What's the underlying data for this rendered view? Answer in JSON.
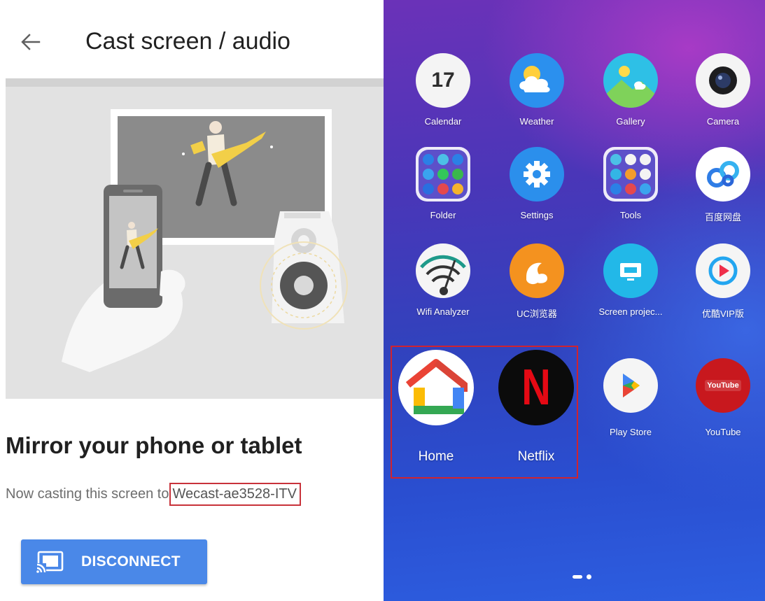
{
  "cast_screen": {
    "title": "Cast screen / audio",
    "heading": "Mirror your phone or tablet",
    "casting_prefix": "Now casting this screen to",
    "device_name": "Wecast-ae3528-ITV",
    "disconnect_label": "DISCONNECT",
    "colors": {
      "button": "#4a88e8",
      "highlight": "#c8323a"
    }
  },
  "home_screen": {
    "apps": [
      {
        "label": "Calendar",
        "icon": "calendar-icon",
        "text": "17"
      },
      {
        "label": "Weather",
        "icon": "weather-icon"
      },
      {
        "label": "Gallery",
        "icon": "gallery-icon"
      },
      {
        "label": "Camera",
        "icon": "camera-icon"
      },
      {
        "label": "Folder",
        "icon": "folder-icon"
      },
      {
        "label": "Settings",
        "icon": "settings-icon"
      },
      {
        "label": "Tools",
        "icon": "tools-icon"
      },
      {
        "label": "百度网盘",
        "icon": "baidu-netdisk-icon"
      },
      {
        "label": "Wifi Analyzer",
        "icon": "wifi-analyzer-icon"
      },
      {
        "label": "UC浏览器",
        "icon": "uc-browser-icon"
      },
      {
        "label": "Screen projec...",
        "icon": "screen-projection-icon"
      },
      {
        "label": "优酷VIP版",
        "icon": "youku-icon"
      },
      {
        "label": "Home",
        "icon": "google-home-icon"
      },
      {
        "label": "Netflix",
        "icon": "netflix-icon",
        "text": "N"
      },
      {
        "label": "Play Store",
        "icon": "play-store-icon"
      },
      {
        "label": "YouTube",
        "icon": "youtube-icon",
        "text": "YouTube"
      }
    ],
    "colors": {
      "highlight": "#d0232f"
    }
  }
}
